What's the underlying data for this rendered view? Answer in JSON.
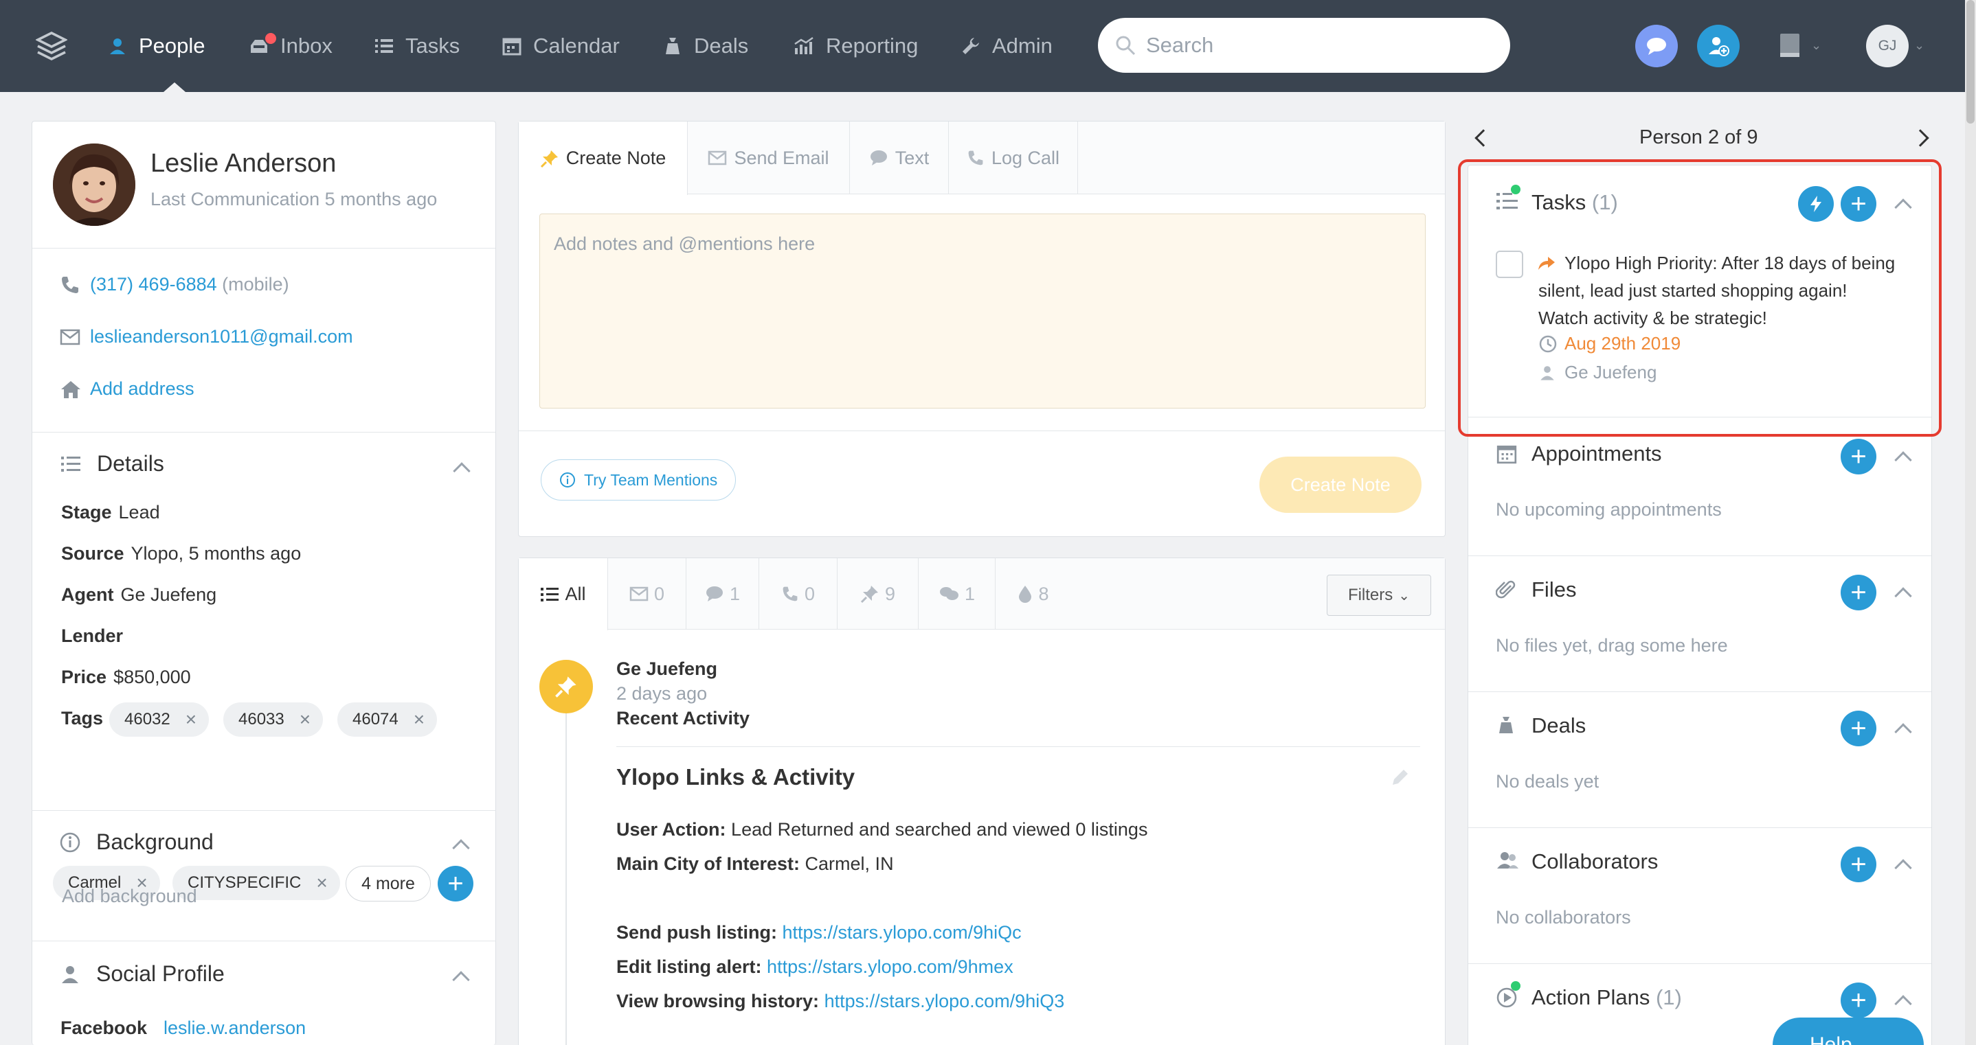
{
  "nav": {
    "items": [
      {
        "label": "People",
        "icon": "person-icon",
        "active": true
      },
      {
        "label": "Inbox",
        "icon": "inbox-icon",
        "active": false
      },
      {
        "label": "Tasks",
        "icon": "list-icon",
        "active": false
      },
      {
        "label": "Calendar",
        "icon": "calendar-icon",
        "active": false
      },
      {
        "label": "Deals",
        "icon": "money-bag-icon",
        "active": false
      },
      {
        "label": "Reporting",
        "icon": "chart-icon",
        "active": false
      },
      {
        "label": "Admin",
        "icon": "wrench-icon",
        "active": false
      }
    ],
    "search_placeholder": "Search",
    "user_initials": "GJ"
  },
  "person": {
    "name": "Leslie Anderson",
    "last_communication": "Last Communication 5 months ago",
    "phone": "(317) 469-6884",
    "phone_type": "(mobile)",
    "email": "leslieanderson1011@gmail.com",
    "add_address": "Add address"
  },
  "details": {
    "title": "Details",
    "stage_label": "Stage",
    "stage": "Lead",
    "source_label": "Source",
    "source": "Ylopo, 5 months ago",
    "agent_label": "Agent",
    "agent": "Ge Juefeng",
    "lender_label": "Lender",
    "price_label": "Price",
    "price": "$850,000",
    "tags_label": "Tags",
    "tags": [
      "46032",
      "46033",
      "46074",
      "Carmel",
      "CITYSPECIFIC"
    ],
    "more_tags": "4 more"
  },
  "background": {
    "title": "Background",
    "placeholder": "Add background"
  },
  "social": {
    "title": "Social Profile",
    "facebook_label": "Facebook",
    "facebook": "leslie.w.anderson"
  },
  "composer": {
    "tabs": [
      {
        "label": "Create Note",
        "icon": "pin-icon"
      },
      {
        "label": "Send Email",
        "icon": "envelope-icon"
      },
      {
        "label": "Text",
        "icon": "speech-bubble-icon"
      },
      {
        "label": "Log Call",
        "icon": "phone-icon"
      }
    ],
    "note_placeholder": "Add notes and @mentions here",
    "team_mentions": "Try Team Mentions",
    "create_note": "Create Note"
  },
  "activity_filters": {
    "all": "All",
    "email_count": "0",
    "text_count": "1",
    "call_count": "0",
    "note_count": "9",
    "chat_count": "1",
    "drip_count": "8",
    "filters": "Filters"
  },
  "activity": {
    "author": "Ge Juefeng",
    "time": "2 days ago",
    "type": "Recent Activity",
    "title": "Ylopo Links & Activity",
    "user_action_label": "User Action:",
    "user_action": "Lead Returned and searched and viewed 0 listings",
    "city_label": "Main City of Interest:",
    "city": "Carmel, IN",
    "push_label": "Send push listing:",
    "push_url": "https://stars.ylopo.com/9hiQc",
    "alert_label": "Edit listing alert:",
    "alert_url": "https://stars.ylopo.com/9hmex",
    "history_label": "View browsing history:",
    "history_url": "https://stars.ylopo.com/9hiQ3"
  },
  "right": {
    "person_count": "Person 2 of 9",
    "tasks_title": "Tasks",
    "tasks_count": "(1)",
    "task_text": "Ylopo High Priority: After 18 days of being silent, lead just started shopping again! Watch activity & be strategic!",
    "task_date": "Aug 29th 2019",
    "task_owner": "Ge Juefeng",
    "appointments_title": "Appointments",
    "appointments_empty": "No upcoming appointments",
    "files_title": "Files",
    "files_empty": "No files yet, drag some here",
    "deals_title": "Deals",
    "deals_empty": "No deals yet",
    "collaborators_title": "Collaborators",
    "collaborators_empty": "No collaborators",
    "action_plans_title": "Action Plans",
    "action_plans_count": "(1)",
    "help": "Help"
  },
  "colors": {
    "accent": "#2a9bd6",
    "nav_bg": "#3a4450",
    "highlight": "#e53b2f",
    "warning": "#f08a38"
  }
}
